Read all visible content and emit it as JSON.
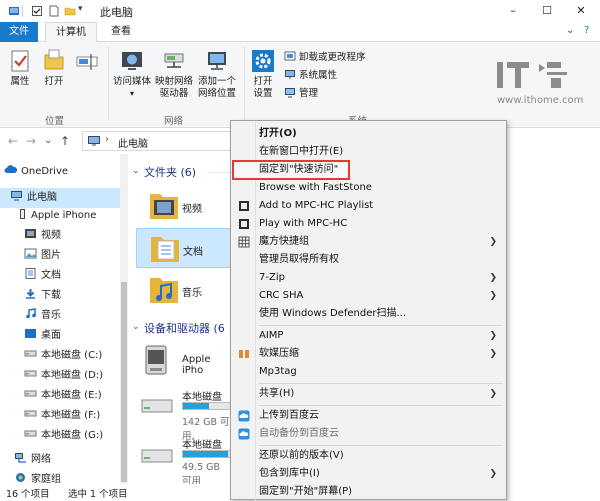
{
  "window": {
    "title": "此电脑",
    "minimize": "–",
    "maximize": "☐",
    "close": "✕"
  },
  "tabs": {
    "file": "文件",
    "computer": "计算机",
    "view": "查看",
    "expand": "⌄",
    "help": "?"
  },
  "ribbon": {
    "properties": "属性",
    "open": "打开",
    "rename": "重命名",
    "group_location": "位置",
    "access_media": "访问媒体",
    "map_drive_line1": "映射网络",
    "map_drive_line2": "驱动器",
    "add_location_line1": "添加一个",
    "add_location_line2": "网络位置",
    "group_network": "网络",
    "open_settings_line1": "打开",
    "open_settings_line2": "设置",
    "uninstall": "卸载或更改程序",
    "system_properties": "系统属性",
    "manage": "管理",
    "group_system": "系统"
  },
  "watermark": {
    "url": "www.ithome.com"
  },
  "address": {
    "back": "←",
    "forward": "→",
    "dropdown": "⌄",
    "up": "↑",
    "path": "此电脑",
    "sep": "›"
  },
  "nav": {
    "onedrive": "OneDrive",
    "this_pc": "此电脑",
    "apple_iphone": "Apple iPhone",
    "videos": "视频",
    "pictures": "图片",
    "documents": "文档",
    "downloads": "下载",
    "music": "音乐",
    "desktop": "桌面",
    "disk_c": "本地磁盘 (C:)",
    "disk_d": "本地磁盘 (D:)",
    "disk_e": "本地磁盘 (E:)",
    "disk_f": "本地磁盘 (F:)",
    "disk_g": "本地磁盘 (G:)",
    "network": "网络",
    "homegroup": "家庭组"
  },
  "content": {
    "folders_header": "文件夹 (6)",
    "folder_videos": "视频",
    "folder_documents": "文档",
    "folder_music": "音乐",
    "devices_header": "设备和驱动器 (6",
    "device_iphone": "Apple iPho",
    "drive1_name": "本地磁盘",
    "drive1_free": "142 GB 可用,",
    "drive1_used": 0.45,
    "drive2_name": "本地磁盘",
    "drive2_free": "49.5 GB 可用",
    "drive2_used": 0.78
  },
  "status": {
    "items": "16 个项目",
    "selected": "选中 1 个项目"
  },
  "menu": {
    "open": "打开(O)",
    "open_new_window": "在新窗口中打开(E)",
    "pin_quick_access": "固定到\"快速访问\"",
    "faststone": "Browse with FastStone",
    "add_mpc": "Add to MPC-HC Playlist",
    "play_mpc": "Play with MPC-HC",
    "magic_cube": "魔方快捷组",
    "admin_ownership": "管理员取得所有权",
    "sevenzip": "7-Zip",
    "crc_sha": "CRC SHA",
    "defender": "使用 Windows Defender扫描...",
    "aimp": "AIMP",
    "compress": "软媒压缩",
    "mp3tag": "Mp3tag",
    "share": "共享(H)",
    "upload_baidu": "上传到百度云",
    "autobackup_baidu": "自动备份到百度云",
    "restore_versions": "还原以前的版本(V)",
    "include_library": "包含到库中(I)",
    "pin_start": "固定到\"开始\"屏幕(P)",
    "submenu_arrow": "❯"
  },
  "colors": {
    "accent": "#1979ca",
    "highlight_box": "#e53935",
    "folder_header": "#1e3287",
    "selection": "#cce8ff",
    "drive_fill": "#26a0da"
  }
}
